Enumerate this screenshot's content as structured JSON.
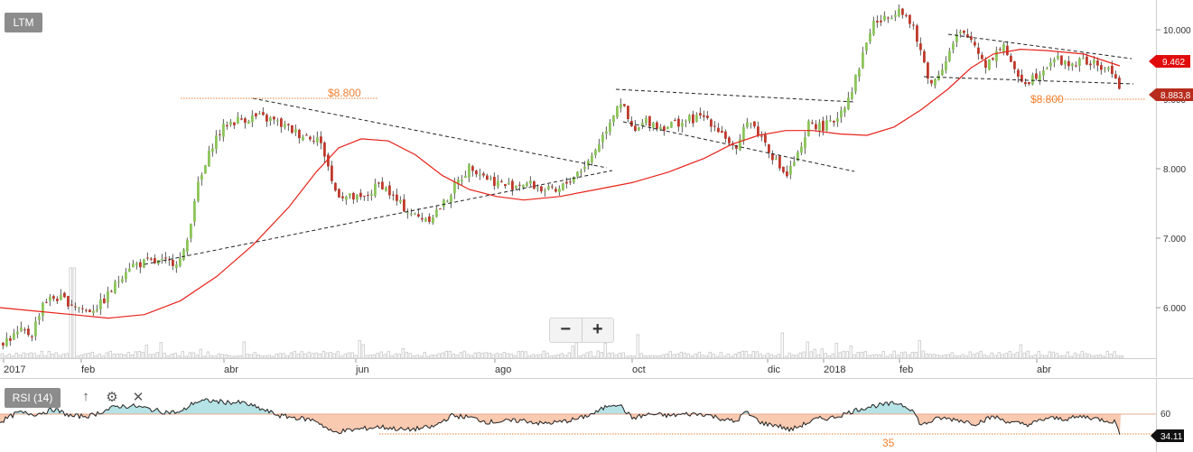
{
  "chart_header": {
    "ticker": "LTM"
  },
  "zoom": {
    "out_label": "−",
    "in_label": "+"
  },
  "rsi_panel": {
    "label": "RSI (14)",
    "level_label": "35",
    "upper_tick": "60",
    "current_value": "34.11"
  },
  "price_tags": {
    "sma_value": "9.462",
    "last_price": "8.883,8"
  },
  "annotations": {
    "resistance_1": "$8.800",
    "resistance_2": "$8.800"
  },
  "colors": {
    "up": "#8cc55a",
    "down": "#c0392b",
    "sma": "#e8221a",
    "annotation": "#f07f2e",
    "rsi_up_fill": "#b6e3e6",
    "rsi_down_fill": "#f9c9b0"
  },
  "chart_data": {
    "type": "candlestick",
    "x_ticks": [
      "2017",
      "feb",
      "abr",
      "jun",
      "ago",
      "oct",
      "dic",
      "2018",
      "feb",
      "abr"
    ],
    "y_ticks": [
      "6.000",
      "7.000",
      "8.000",
      "9.000",
      "10.000"
    ],
    "ylim": [
      5400,
      10450
    ],
    "close_series": [
      [
        0,
        5500
      ],
      [
        12,
        5580
      ],
      [
        22,
        5650
      ],
      [
        34,
        5620
      ],
      [
        46,
        6080
      ],
      [
        60,
        6150
      ],
      [
        75,
        6080
      ],
      [
        95,
        5950
      ],
      [
        110,
        6050
      ],
      [
        125,
        6300
      ],
      [
        140,
        6600
      ],
      [
        160,
        6650
      ],
      [
        185,
        6650
      ],
      [
        200,
        6700
      ],
      [
        205,
        6900
      ],
      [
        215,
        7650
      ],
      [
        225,
        8000
      ],
      [
        235,
        8400
      ],
      [
        250,
        8650
      ],
      [
        262,
        8700
      ],
      [
        280,
        8750
      ],
      [
        300,
        8700
      ],
      [
        315,
        8600
      ],
      [
        330,
        8500
      ],
      [
        350,
        8450
      ],
      [
        360,
        8150
      ],
      [
        368,
        7700
      ],
      [
        380,
        7600
      ],
      [
        400,
        7550
      ],
      [
        420,
        7800
      ],
      [
        440,
        7500
      ],
      [
        460,
        7300
      ],
      [
        475,
        7300
      ],
      [
        490,
        7500
      ],
      [
        505,
        7800
      ],
      [
        520,
        8050
      ],
      [
        540,
        7850
      ],
      [
        560,
        7750
      ],
      [
        580,
        7800
      ],
      [
        600,
        7700
      ],
      [
        615,
        7650
      ],
      [
        630,
        7850
      ],
      [
        650,
        8100
      ],
      [
        665,
        8450
      ],
      [
        685,
        9000
      ],
      [
        700,
        8500
      ],
      [
        715,
        8700
      ],
      [
        730,
        8600
      ],
      [
        745,
        8650
      ],
      [
        760,
        8700
      ],
      [
        780,
        8750
      ],
      [
        800,
        8500
      ],
      [
        815,
        8200
      ],
      [
        825,
        8750
      ],
      [
        845,
        8400
      ],
      [
        860,
        8050
      ],
      [
        870,
        7900
      ],
      [
        880,
        8150
      ],
      [
        888,
        8300
      ],
      [
        895,
        8700
      ],
      [
        905,
        8600
      ],
      [
        920,
        8650
      ],
      [
        935,
        8950
      ],
      [
        945,
        9250
      ],
      [
        955,
        9700
      ],
      [
        965,
        10100
      ],
      [
        980,
        10150
      ],
      [
        995,
        10350
      ],
      [
        1010,
        10000
      ],
      [
        1020,
        9600
      ],
      [
        1030,
        9200
      ],
      [
        1045,
        9550
      ],
      [
        1060,
        9950
      ],
      [
        1075,
        9850
      ],
      [
        1090,
        9500
      ],
      [
        1100,
        9650
      ],
      [
        1110,
        9800
      ],
      [
        1120,
        9400
      ],
      [
        1135,
        9250
      ],
      [
        1150,
        9400
      ],
      [
        1165,
        9600
      ],
      [
        1180,
        9500
      ],
      [
        1200,
        9550
      ],
      [
        1220,
        9450
      ],
      [
        1235,
        9350
      ],
      [
        1241,
        8880
      ]
    ],
    "sma_series": [
      [
        0,
        6000
      ],
      [
        40,
        5950
      ],
      [
        80,
        5900
      ],
      [
        120,
        5850
      ],
      [
        160,
        5900
      ],
      [
        200,
        6100
      ],
      [
        240,
        6450
      ],
      [
        280,
        6900
      ],
      [
        320,
        7450
      ],
      [
        350,
        7950
      ],
      [
        375,
        8300
      ],
      [
        400,
        8430
      ],
      [
        430,
        8400
      ],
      [
        460,
        8200
      ],
      [
        490,
        7900
      ],
      [
        520,
        7700
      ],
      [
        550,
        7600
      ],
      [
        580,
        7550
      ],
      [
        620,
        7600
      ],
      [
        660,
        7700
      ],
      [
        700,
        7800
      ],
      [
        740,
        7950
      ],
      [
        780,
        8150
      ],
      [
        810,
        8350
      ],
      [
        840,
        8480
      ],
      [
        870,
        8550
      ],
      [
        900,
        8550
      ],
      [
        930,
        8500
      ],
      [
        960,
        8480
      ],
      [
        990,
        8600
      ],
      [
        1020,
        8850
      ],
      [
        1050,
        9150
      ],
      [
        1075,
        9450
      ],
      [
        1100,
        9650
      ],
      [
        1130,
        9720
      ],
      [
        1160,
        9700
      ],
      [
        1200,
        9650
      ],
      [
        1240,
        9480
      ]
    ],
    "rsi_series": [
      [
        0,
        50
      ],
      [
        20,
        62
      ],
      [
        40,
        60
      ],
      [
        60,
        66
      ],
      [
        80,
        57
      ],
      [
        100,
        58
      ],
      [
        115,
        64
      ],
      [
        130,
        70
      ],
      [
        150,
        70
      ],
      [
        180,
        63
      ],
      [
        200,
        62
      ],
      [
        215,
        75
      ],
      [
        230,
        77
      ],
      [
        250,
        75
      ],
      [
        270,
        74
      ],
      [
        290,
        66
      ],
      [
        310,
        58
      ],
      [
        330,
        55
      ],
      [
        350,
        52
      ],
      [
        368,
        37
      ],
      [
        390,
        40
      ],
      [
        420,
        44
      ],
      [
        450,
        40
      ],
      [
        480,
        44
      ],
      [
        500,
        58
      ],
      [
        520,
        56
      ],
      [
        540,
        50
      ],
      [
        560,
        51
      ],
      [
        580,
        52
      ],
      [
        600,
        48
      ],
      [
        620,
        50
      ],
      [
        640,
        54
      ],
      [
        660,
        62
      ],
      [
        675,
        72
      ],
      [
        685,
        73
      ],
      [
        700,
        55
      ],
      [
        720,
        60
      ],
      [
        740,
        58
      ],
      [
        760,
        60
      ],
      [
        780,
        60
      ],
      [
        800,
        54
      ],
      [
        815,
        50
      ],
      [
        825,
        63
      ],
      [
        845,
        48
      ],
      [
        860,
        46
      ],
      [
        875,
        40
      ],
      [
        890,
        47
      ],
      [
        905,
        54
      ],
      [
        920,
        55
      ],
      [
        935,
        60
      ],
      [
        950,
        66
      ],
      [
        965,
        70
      ],
      [
        980,
        72
      ],
      [
        995,
        74
      ],
      [
        1010,
        66
      ],
      [
        1020,
        46
      ],
      [
        1040,
        55
      ],
      [
        1060,
        53
      ],
      [
        1080,
        48
      ],
      [
        1100,
        57
      ],
      [
        1120,
        49
      ],
      [
        1140,
        47
      ],
      [
        1160,
        55
      ],
      [
        1180,
        54
      ],
      [
        1200,
        57
      ],
      [
        1220,
        53
      ],
      [
        1235,
        50
      ],
      [
        1241,
        34
      ]
    ],
    "rsi_ylim": [
      30,
      80
    ],
    "rsi_level": 35,
    "rsi_upper": 60
  }
}
